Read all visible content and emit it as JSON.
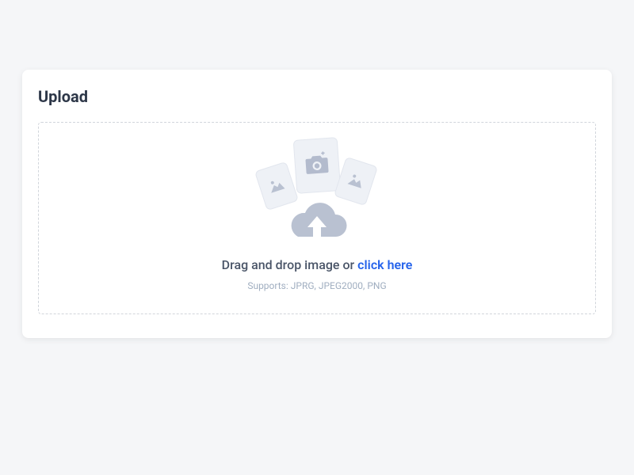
{
  "card": {
    "title": "Upload"
  },
  "dropzone": {
    "prompt_text": "Drag and drop image or ",
    "link_text": "click here",
    "support_text": "Supports: JPRG, JPEG2000, PNG"
  }
}
